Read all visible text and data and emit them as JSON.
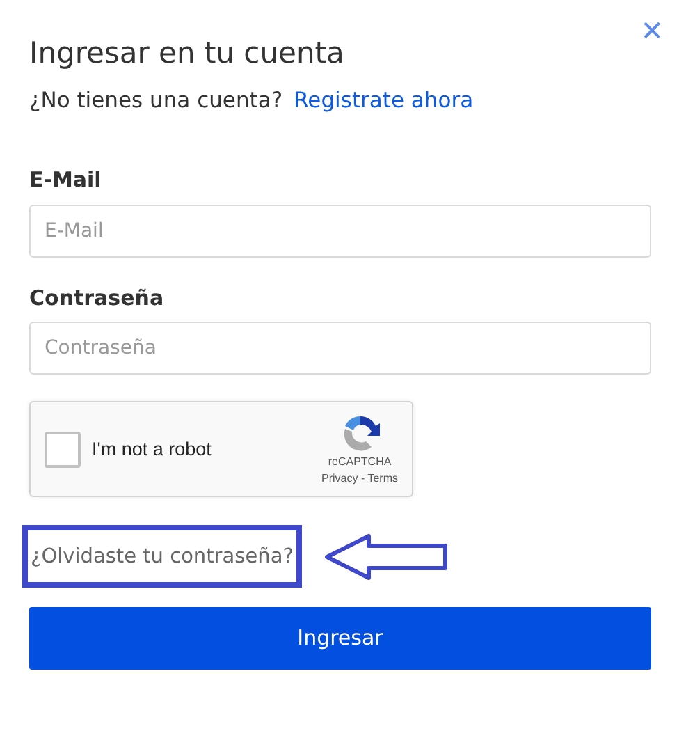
{
  "dialog": {
    "title": "Ingresar en tu cuenta",
    "close": "✕",
    "signup_prompt": "¿No tienes una cuenta?",
    "signup_link": "Registrate ahora"
  },
  "fields": [
    {
      "label": "E-Mail",
      "placeholder": "E-Mail"
    },
    {
      "label": "Contraseña",
      "placeholder": "Contraseña"
    }
  ],
  "captcha": {
    "label": "I'm not a robot",
    "checked": false,
    "brand": "reCAPTCHA",
    "links": "Privacy - Terms"
  },
  "forgot_link": "¿Olvidaste tu contraseña?",
  "annotation": {
    "highlighted": true
  },
  "submit": "Ingresar"
}
